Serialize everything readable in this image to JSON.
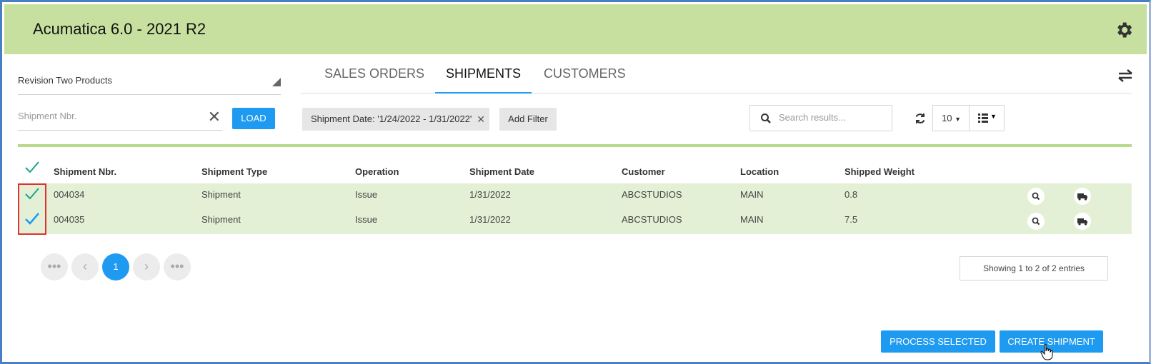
{
  "app": {
    "title": "Acumatica 6.0 - 2021 R2"
  },
  "left_panel": {
    "company": "Revision Two Products",
    "shipment_nbr_placeholder": "Shipment Nbr.",
    "load_label": "LOAD"
  },
  "tabs": [
    {
      "label": "SALES ORDERS",
      "active": false
    },
    {
      "label": "SHIPMENTS",
      "active": true
    },
    {
      "label": "CUSTOMERS",
      "active": false
    }
  ],
  "toolbar": {
    "filter_chip": "Shipment Date: '1/24/2022 - 1/31/2022'",
    "add_filter": "Add Filter",
    "search_placeholder": "Search results...",
    "page_size": "10"
  },
  "table": {
    "columns": [
      "Shipment Nbr.",
      "Shipment Type",
      "Operation",
      "Shipment Date",
      "Customer",
      "Location",
      "Shipped Weight"
    ],
    "rows": [
      {
        "nbr": "004034",
        "type": "Shipment",
        "operation": "Issue",
        "date": "1/31/2022",
        "customer": "ABCSTUDIOS",
        "location": "MAIN",
        "weight": "0.8",
        "checked": true
      },
      {
        "nbr": "004035",
        "type": "Shipment",
        "operation": "Issue",
        "date": "1/31/2022",
        "customer": "ABCSTUDIOS",
        "location": "MAIN",
        "weight": "7.5",
        "checked": true
      }
    ]
  },
  "pagination": {
    "first": "•••",
    "prev": "‹",
    "current": "1",
    "next": "›",
    "last": "•••",
    "entries_text": "Showing 1 to 2 of 2 entries"
  },
  "actions": {
    "process_selected": "PROCESS SELECTED",
    "create_shipment": "CREATE SHIPMENT"
  },
  "colors": {
    "header": "#c7e0a0",
    "accent": "#1e9bf0",
    "row_highlight": "#e3f0d5",
    "selection_outline": "#e03030"
  }
}
